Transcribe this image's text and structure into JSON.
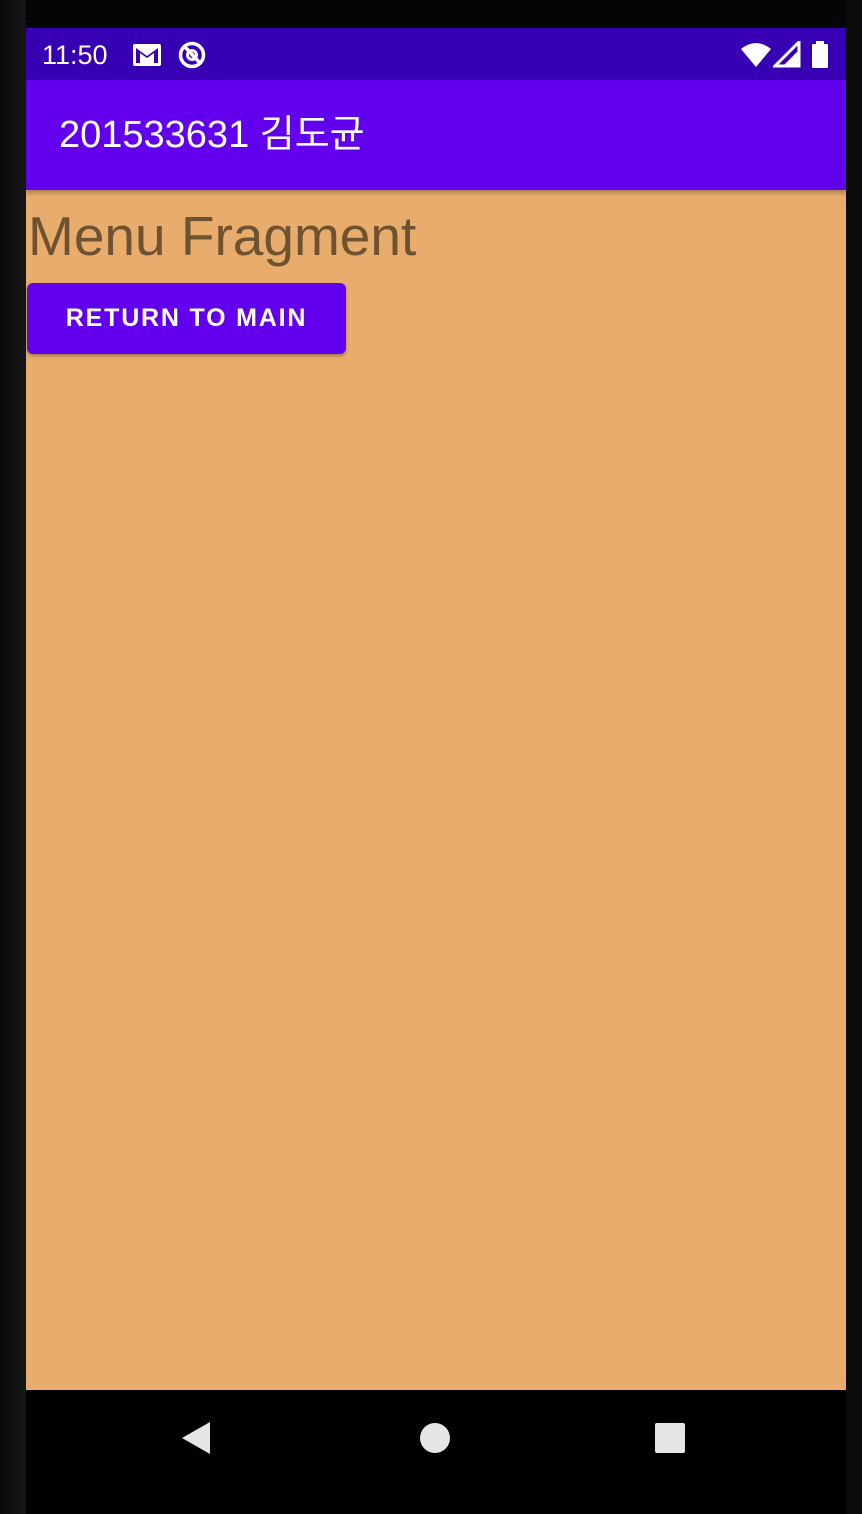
{
  "status_bar": {
    "time": "11:50",
    "background": "#3700B3",
    "left_icons": [
      "gmail-icon",
      "at-sign-icon"
    ],
    "right_icons": [
      "wifi-icon",
      "cellular-signal-icon",
      "battery-icon"
    ]
  },
  "app_bar": {
    "title": "201533631 김도균",
    "background": "#6200EE"
  },
  "content": {
    "background": "#E8AD6C",
    "fragment_title": "Menu Fragment",
    "return_button_label": "RETURN TO MAIN",
    "button_color": "#6200EE"
  },
  "navigation_bar": {
    "buttons": [
      "back-icon",
      "home-icon",
      "recents-icon"
    ]
  }
}
